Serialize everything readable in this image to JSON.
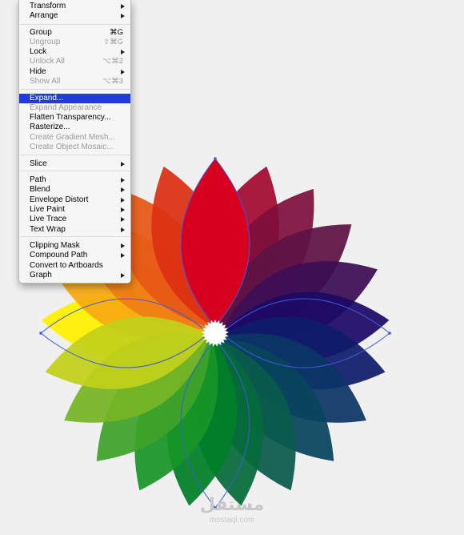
{
  "menu": {
    "items": [
      {
        "label": "Transform",
        "shortcut": "",
        "submenu": true,
        "disabled": false,
        "highlighted": false
      },
      {
        "label": "Arrange",
        "shortcut": "",
        "submenu": true,
        "disabled": false,
        "highlighted": false
      },
      {
        "label": "Group",
        "shortcut": "⌘G",
        "submenu": false,
        "disabled": false,
        "highlighted": false
      },
      {
        "label": "Ungroup",
        "shortcut": "⇧⌘G",
        "submenu": false,
        "disabled": true,
        "highlighted": false
      },
      {
        "label": "Lock",
        "shortcut": "",
        "submenu": true,
        "disabled": false,
        "highlighted": false
      },
      {
        "label": "Unlock All",
        "shortcut": "⌥⌘2",
        "submenu": false,
        "disabled": true,
        "highlighted": false
      },
      {
        "label": "Hide",
        "shortcut": "",
        "submenu": true,
        "disabled": false,
        "highlighted": false
      },
      {
        "label": "Show All",
        "shortcut": "⌥⌘3",
        "submenu": false,
        "disabled": true,
        "highlighted": false
      },
      {
        "label": "Expand...",
        "shortcut": "",
        "submenu": false,
        "disabled": false,
        "highlighted": true
      },
      {
        "label": "Expand Appearance",
        "shortcut": "",
        "submenu": false,
        "disabled": true,
        "highlighted": false
      },
      {
        "label": "Flatten Transparency...",
        "shortcut": "",
        "submenu": false,
        "disabled": false,
        "highlighted": false
      },
      {
        "label": "Rasterize...",
        "shortcut": "",
        "submenu": false,
        "disabled": false,
        "highlighted": false
      },
      {
        "label": "Create Gradient Mesh...",
        "shortcut": "",
        "submenu": false,
        "disabled": true,
        "highlighted": false
      },
      {
        "label": "Create Object Mosaic...",
        "shortcut": "",
        "submenu": false,
        "disabled": true,
        "highlighted": false
      },
      {
        "label": "Slice",
        "shortcut": "",
        "submenu": true,
        "disabled": false,
        "highlighted": false
      },
      {
        "label": "Path",
        "shortcut": "",
        "submenu": true,
        "disabled": false,
        "highlighted": false
      },
      {
        "label": "Blend",
        "shortcut": "",
        "submenu": true,
        "disabled": false,
        "highlighted": false
      },
      {
        "label": "Envelope Distort",
        "shortcut": "",
        "submenu": true,
        "disabled": false,
        "highlighted": false
      },
      {
        "label": "Live Paint",
        "shortcut": "",
        "submenu": true,
        "disabled": false,
        "highlighted": false
      },
      {
        "label": "Live Trace",
        "shortcut": "",
        "submenu": true,
        "disabled": false,
        "highlighted": false
      },
      {
        "label": "Text Wrap",
        "shortcut": "",
        "submenu": true,
        "disabled": false,
        "highlighted": false
      },
      {
        "label": "Clipping Mask",
        "shortcut": "",
        "submenu": true,
        "disabled": false,
        "highlighted": false
      },
      {
        "label": "Compound Path",
        "shortcut": "",
        "submenu": true,
        "disabled": false,
        "highlighted": false
      },
      {
        "label": "Convert to Artboards",
        "shortcut": "",
        "submenu": false,
        "disabled": false,
        "highlighted": false
      },
      {
        "label": "Graph",
        "shortcut": "",
        "submenu": true,
        "disabled": false,
        "highlighted": false
      }
    ]
  },
  "artwork": {
    "petal_colors": [
      "#d8001f",
      "#a30a30",
      "#7e0f3c",
      "#5e1244",
      "#3c0e55",
      "#1c0a66",
      "#0f1c6b",
      "#0c3566",
      "#07455d",
      "#0b5a4c",
      "#056b3a",
      "#007f27",
      "#189427",
      "#3ea22a",
      "#76b525",
      "#c2d11a",
      "#fff000",
      "#f7aa10",
      "#ef7f14",
      "#e65816",
      "#dc3012"
    ],
    "center_color": "#ffffff",
    "selection_color": "#3b5bdb"
  },
  "watermark": {
    "arabic": "مستقل",
    "latin": "mostaql.com"
  }
}
